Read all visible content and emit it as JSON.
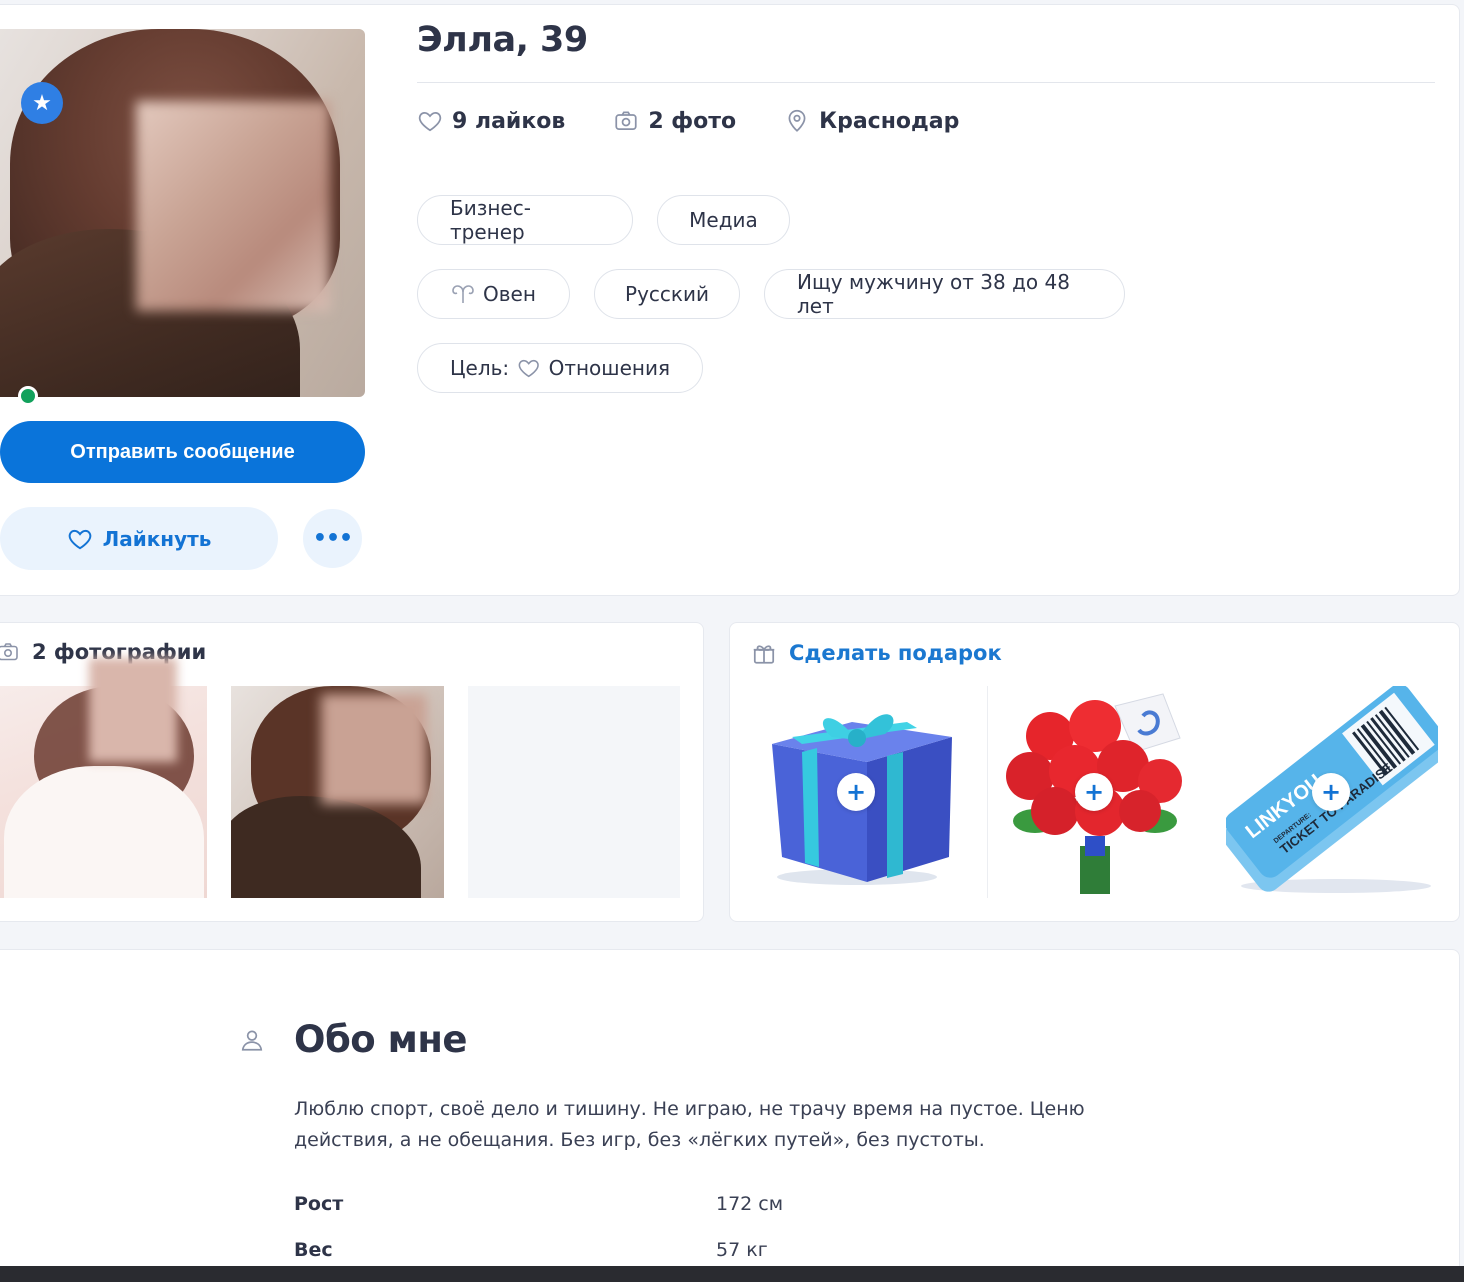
{
  "profile": {
    "name_age": "Элла, 39",
    "send_message_label": "Отправить сообщение",
    "like_label": "Лайкнуть",
    "more_label": "•••",
    "stats": {
      "likes": "9 лайков",
      "photos": "2 фото",
      "city": "Краснодар"
    },
    "tags": {
      "profession": "Бизнес-тренер",
      "industry": "Медиа",
      "zodiac": "Овен",
      "language": "Русский",
      "looking_for": "Ищу мужчину от 38 до 48 лет",
      "goal_label": "Цель:",
      "goal_value": "Отношения"
    }
  },
  "photos": {
    "title": "2 фотографии"
  },
  "gifts": {
    "title": "Сделать подарок",
    "items": [
      {
        "icon": "gift-box-icon",
        "plus": "+"
      },
      {
        "icon": "rose-bouquet-icon",
        "plus": "+"
      },
      {
        "icon": "ticket-icon",
        "plus": "+",
        "ticket_brand": "LINKYOU",
        "ticket_text": "TICKET TO PARADISE",
        "ticket_small": "DEPARTURE:"
      }
    ]
  },
  "about": {
    "title": "Обо мне",
    "text": "Люблю спорт, своё дело и тишину. Не играю, не трачу время на пустое. Ценю действия, а не обещания. Без игр, без «лёгких путей», без пустоты.",
    "params": [
      {
        "label": "Рост",
        "value": "172 см"
      },
      {
        "label": "Вес",
        "value": "57 кг"
      }
    ]
  },
  "colors": {
    "accent": "#0a74da",
    "online": "#12a15c",
    "like_bg": "#eaf3fd"
  }
}
